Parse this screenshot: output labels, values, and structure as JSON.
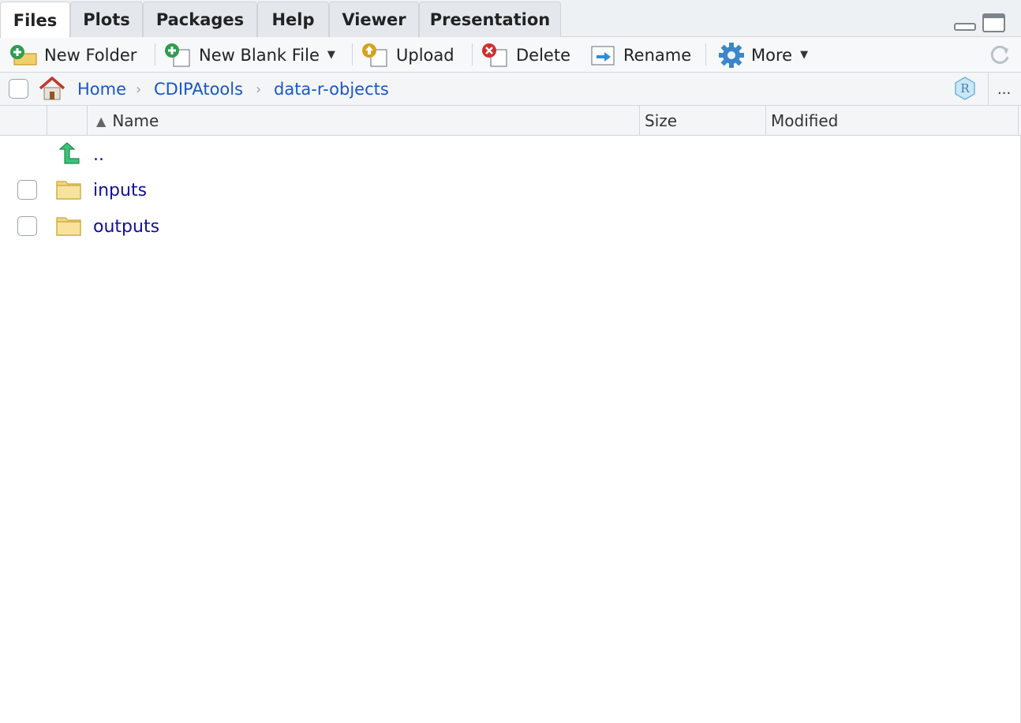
{
  "tabs": [
    {
      "label": "Files",
      "active": true
    },
    {
      "label": "Plots",
      "active": false
    },
    {
      "label": "Packages",
      "active": false
    },
    {
      "label": "Help",
      "active": false
    },
    {
      "label": "Viewer",
      "active": false
    },
    {
      "label": "Presentation",
      "active": false
    }
  ],
  "toolbar": {
    "new_folder": "New Folder",
    "new_blank_file": "New Blank File",
    "upload": "Upload",
    "delete": "Delete",
    "rename": "Rename",
    "more": "More"
  },
  "breadcrumb": {
    "items": [
      "Home",
      "CDIPAtools",
      "data-r-objects"
    ],
    "overflow": "..."
  },
  "columns": {
    "name": "Name",
    "size": "Size",
    "modified": "Modified"
  },
  "files": [
    {
      "name": "..",
      "kind": "parent"
    },
    {
      "name": "inputs",
      "kind": "folder"
    },
    {
      "name": "outputs",
      "kind": "folder"
    }
  ],
  "icons": {
    "home": "home-icon",
    "folder": "folder-icon",
    "up": "up-arrow-icon",
    "gear": "gear-icon",
    "refresh": "refresh-icon",
    "r_project": "r-project-icon"
  },
  "colors": {
    "link": "#1a57c4",
    "file_link": "#10109c",
    "toolbar_bg": "#f7f8f9",
    "tab_bg": "#e4e8ec"
  }
}
